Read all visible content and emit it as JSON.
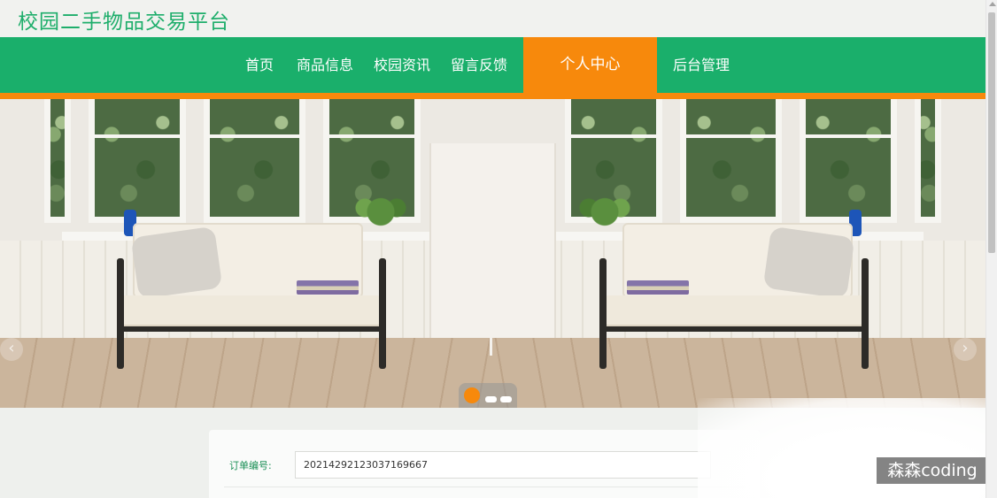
{
  "site": {
    "title": "校园二手物品交易平台"
  },
  "nav": {
    "items": [
      "首页",
      "商品信息",
      "校园资讯",
      "留言反馈"
    ],
    "active": "个人中心",
    "admin": "后台管理"
  },
  "carousel": {
    "prev_icon": "‹",
    "next_icon": "›",
    "slide_count": 3,
    "active_index": 0
  },
  "order": {
    "label": "订单编号:",
    "value": "20214292123037169667"
  },
  "watermark": "森森coding",
  "colors": {
    "brand_green": "#1aaf6b",
    "accent_orange": "#f7890c",
    "title_green": "#1eae6b"
  }
}
